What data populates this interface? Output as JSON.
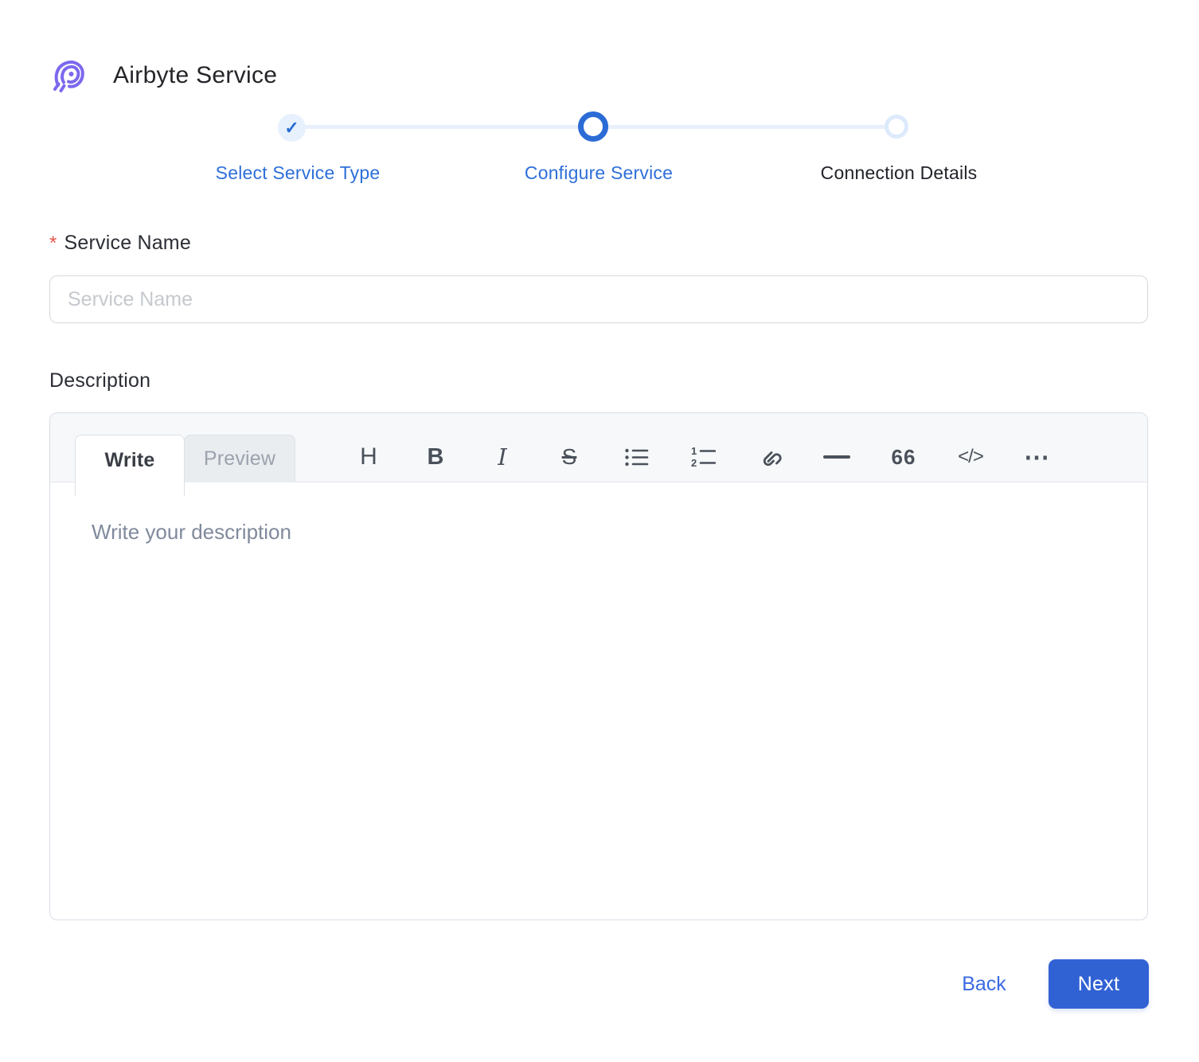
{
  "header": {
    "title": "Airbyte Service",
    "logo_icon": "airbyte-octopus-logo",
    "logo_color": "#7b68ee"
  },
  "stepper": {
    "check_glyph": "✓",
    "steps": [
      {
        "label": "Select Service Type",
        "state": "completed",
        "icon": "check-icon"
      },
      {
        "label": "Configure Service",
        "state": "active",
        "icon": "filled-ring-icon"
      },
      {
        "label": "Connection Details",
        "state": "upcoming",
        "icon": "light-ring-icon"
      }
    ],
    "active_color": "#2b6bd6",
    "label_active_color": "#2e6fd9",
    "label_upcoming_color": "#212329"
  },
  "form": {
    "service_name": {
      "label": "Service Name",
      "required_marker": "*",
      "placeholder": "Service Name",
      "value": ""
    },
    "description": {
      "label": "Description",
      "placeholder": "Write your description",
      "value": "",
      "tabs": [
        {
          "label": "Write",
          "active": true
        },
        {
          "label": "Preview",
          "active": false
        }
      ],
      "toolbar": [
        {
          "name": "heading",
          "glyph": "H"
        },
        {
          "name": "bold",
          "glyph": "B"
        },
        {
          "name": "italic",
          "glyph": "I"
        },
        {
          "name": "strikethrough",
          "glyph": "S"
        },
        {
          "name": "unordered-list",
          "icon": "bullet-list-icon"
        },
        {
          "name": "ordered-list",
          "icon": "numbered-list-icon"
        },
        {
          "name": "link",
          "icon": "chain-link-icon"
        },
        {
          "name": "horizontal-rule",
          "icon": "horizontal-rule-icon"
        },
        {
          "name": "quote",
          "glyph": "66"
        },
        {
          "name": "code",
          "glyph": "</>"
        },
        {
          "name": "more",
          "glyph": "⋯"
        }
      ]
    }
  },
  "actions": {
    "back_label": "Back",
    "next_label": "Next"
  },
  "colors": {
    "accent_blue": "#2e6fd9",
    "button_blue": "#3162d4",
    "brand_purple": "#7b68ee",
    "required_red": "#e2574c",
    "toolbar_bg": "#f6f8fa",
    "border_gray": "#d9dee6"
  }
}
